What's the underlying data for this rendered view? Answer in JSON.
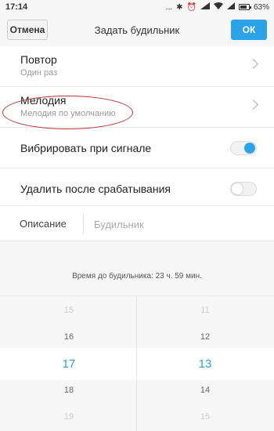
{
  "status_bar": {
    "time": "17:14",
    "dots": "...",
    "battery_percent": "63%"
  },
  "header": {
    "cancel_label": "Отмена",
    "title": "Задать будильник",
    "ok_label": "ОК"
  },
  "settings": {
    "repeat": {
      "title": "Повтор",
      "value": "Один раз"
    },
    "ringtone": {
      "title": "Мелодия",
      "value": "Мелодия по умолчанию"
    },
    "vibrate": {
      "title": "Вибрировать при сигнале",
      "enabled": true
    },
    "delete_after": {
      "title": "Удалить после срабатывания",
      "enabled": false
    }
  },
  "description": {
    "label": "Описание",
    "placeholder": "Будильник"
  },
  "countdown": "Время до будильника: 23 ч. 59 мин.",
  "picker": {
    "hours": [
      "15",
      "16",
      "17",
      "18",
      "19"
    ],
    "minutes": [
      "11",
      "12",
      "13",
      "14",
      "15"
    ],
    "selected_hour": "17",
    "selected_minute": "13"
  },
  "colors": {
    "accent": "#2aa3e8",
    "annotation": "#b33333"
  }
}
